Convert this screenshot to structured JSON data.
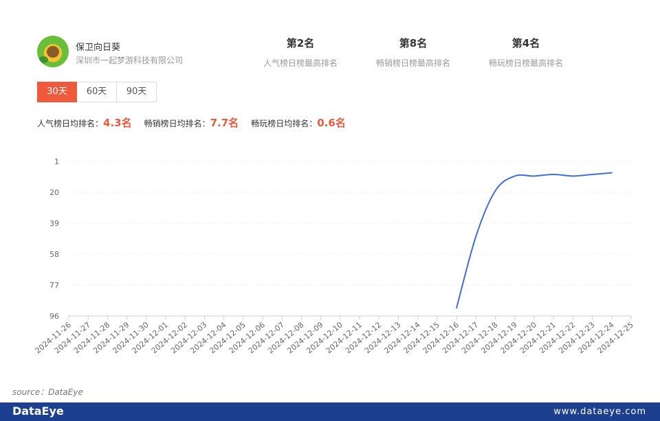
{
  "app": {
    "name": "保卫向日葵",
    "publisher": "深圳市一起梦游科技有限公司"
  },
  "stats": [
    {
      "value": "第2名",
      "label": "人气榜日榜最高排名"
    },
    {
      "value": "第8名",
      "label": "畅销榜日榜最高排名"
    },
    {
      "value": "第4名",
      "label": "畅玩榜日榜最高排名"
    }
  ],
  "tabs": [
    {
      "label": "30天",
      "active": true
    },
    {
      "label": "60天",
      "active": false
    },
    {
      "label": "90天",
      "active": false
    }
  ],
  "averages": [
    {
      "label": "人气榜日均排名：",
      "value": "4.3名"
    },
    {
      "label": "畅销榜日均排名：",
      "value": "7.7名"
    },
    {
      "label": "畅玩榜日均排名：",
      "value": "0.6名"
    }
  ],
  "chart_data": {
    "type": "line",
    "title": "",
    "xlabel": "",
    "ylabel": "",
    "y_inverted": true,
    "ylim": [
      1,
      96
    ],
    "yticks": [
      "1",
      "20",
      "39",
      "58",
      "77",
      "96"
    ],
    "grid": true,
    "line_color": "#3a6fd8",
    "categories": [
      "2024-11-26",
      "2024-11-27",
      "2024-11-28",
      "2024-11-29",
      "2024-11-30",
      "2024-12-01",
      "2024-12-02",
      "2024-12-03",
      "2024-12-04",
      "2024-12-05",
      "2024-12-06",
      "2024-12-07",
      "2024-12-08",
      "2024-12-09",
      "2024-12-10",
      "2024-12-11",
      "2024-12-12",
      "2024-12-13",
      "2024-12-14",
      "2024-12-15",
      "2024-12-16",
      "2024-12-17",
      "2024-12-18",
      "2024-12-19",
      "2024-12-20",
      "2024-12-21",
      "2024-12-22",
      "2024-12-23",
      "2024-12-24",
      "2024-12-25"
    ],
    "series": [
      {
        "values": [
          null,
          null,
          null,
          null,
          null,
          null,
          null,
          null,
          null,
          null,
          null,
          null,
          null,
          null,
          null,
          null,
          null,
          null,
          null,
          null,
          91,
          47,
          19,
          10,
          10,
          9,
          10,
          9,
          8,
          null
        ]
      }
    ]
  },
  "source": "source：DataEye",
  "footer": {
    "brand": "DataEye",
    "url": "www.dataeye.com"
  }
}
